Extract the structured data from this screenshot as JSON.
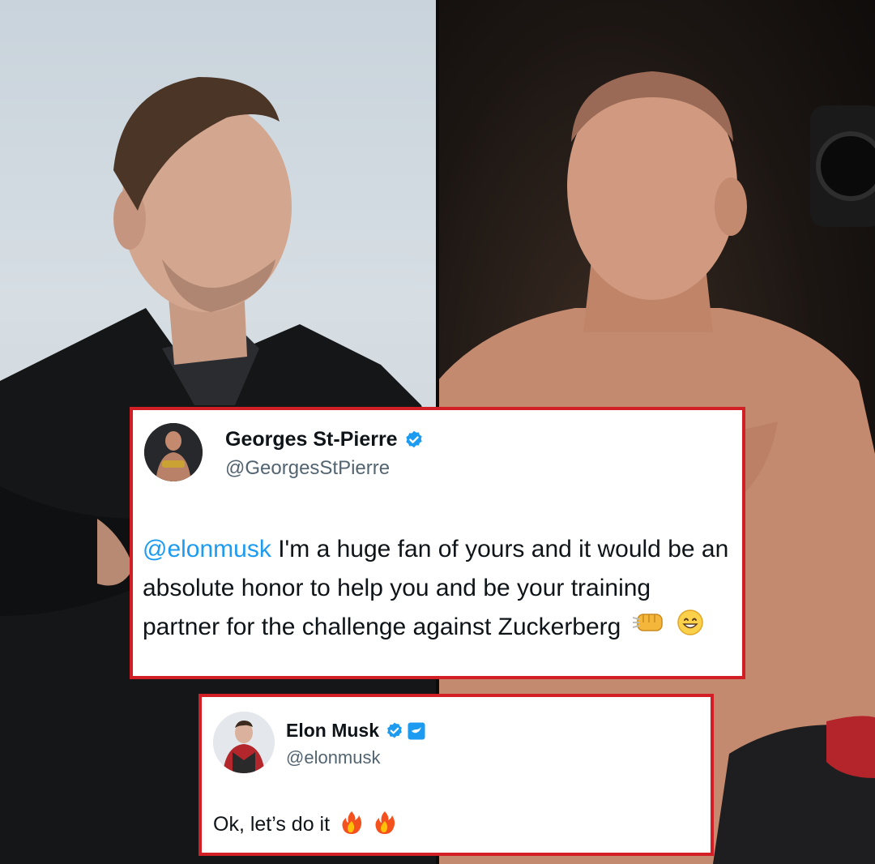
{
  "tweets": [
    {
      "author_name": "Georges St-Pierre",
      "handle": "@GeorgesStPierre",
      "verified": true,
      "mention": "@elonmusk",
      "text": " I'm a huge fan of yours and it would be an absolute honor to help you and be your training partner for the challenge against Zuckerberg",
      "emojis": [
        "fist-bump-emoji",
        "grinning-face-emoji"
      ]
    },
    {
      "author_name": "Elon Musk",
      "handle": "@elonmusk",
      "verified": true,
      "affiliate_badge": true,
      "text": "Ok, let’s do it",
      "emojis": [
        "fire-emoji",
        "fire-emoji"
      ]
    }
  ],
  "colors": {
    "card_border": "#d21f26",
    "verified_blue": "#1d9bf0",
    "mention_blue": "#1d9bf0",
    "handle_gray": "#536471",
    "text": "#0f1419"
  }
}
